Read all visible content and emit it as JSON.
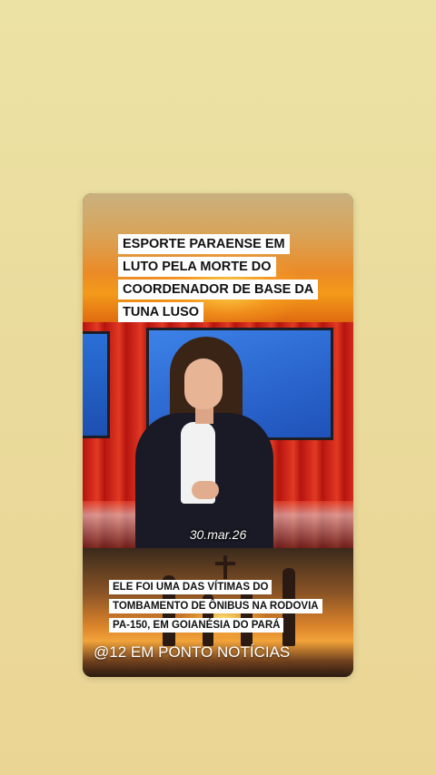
{
  "post": {
    "headline": "ESPORTE PARAENSE EM LUTO PELA MORTE DO COORDENADOR DE BASE DA TUNA LUSO",
    "date_stamp": "30.mar.26",
    "tv_logo": "1",
    "caption": "ELE FOI UMA DAS VÍTIMAS DO TOMBAMENTO DE ÔNIBUS NA RODOVIA PA-150, EM GOIANÉSIA DO PARÁ",
    "handle": "@12 EM PONTO NOTÍCIAS"
  },
  "colors": {
    "page_background": "#ebdc9e",
    "studio_red": "#d12a1c",
    "screen_blue": "#2b67cf",
    "logo_orange": "#ff5a30",
    "text_box": "#ffffff",
    "text": "#111111"
  }
}
